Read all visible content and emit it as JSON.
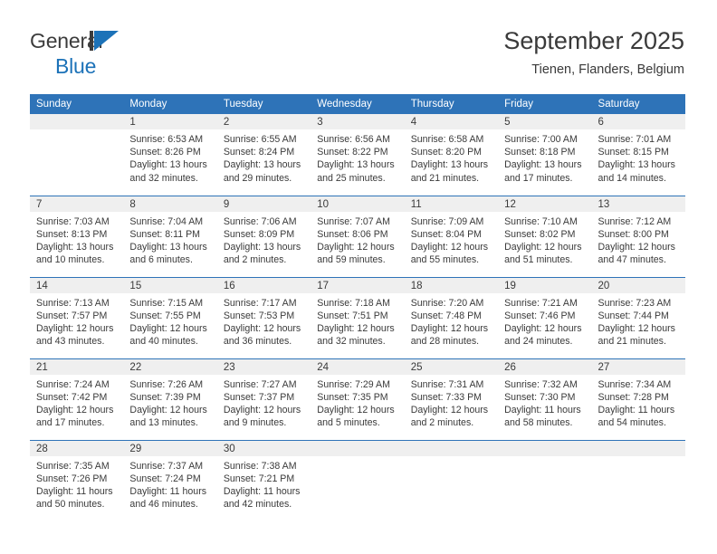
{
  "brand": {
    "name_top": "General",
    "name_bottom": "Blue",
    "accent_color": "#1c72b8",
    "text_color": "#3c3c3c"
  },
  "header": {
    "title": "September 2025",
    "subtitle": "Tienen, Flanders, Belgium"
  },
  "theme": {
    "header_blue": "#2e73b8",
    "daynum_band": "#efefef",
    "text": "#3a3a3a"
  },
  "calendar": {
    "weekday_headers": [
      "Sunday",
      "Monday",
      "Tuesday",
      "Wednesday",
      "Thursday",
      "Friday",
      "Saturday"
    ],
    "weeks": [
      [
        {
          "day": "",
          "empty": true,
          "sunrise": "",
          "sunset": "",
          "daylight_line1": "",
          "daylight_line2": ""
        },
        {
          "day": "1",
          "empty": false,
          "sunrise": "Sunrise: 6:53 AM",
          "sunset": "Sunset: 8:26 PM",
          "daylight_line1": "Daylight: 13 hours",
          "daylight_line2": "and 32 minutes."
        },
        {
          "day": "2",
          "empty": false,
          "sunrise": "Sunrise: 6:55 AM",
          "sunset": "Sunset: 8:24 PM",
          "daylight_line1": "Daylight: 13 hours",
          "daylight_line2": "and 29 minutes."
        },
        {
          "day": "3",
          "empty": false,
          "sunrise": "Sunrise: 6:56 AM",
          "sunset": "Sunset: 8:22 PM",
          "daylight_line1": "Daylight: 13 hours",
          "daylight_line2": "and 25 minutes."
        },
        {
          "day": "4",
          "empty": false,
          "sunrise": "Sunrise: 6:58 AM",
          "sunset": "Sunset: 8:20 PM",
          "daylight_line1": "Daylight: 13 hours",
          "daylight_line2": "and 21 minutes."
        },
        {
          "day": "5",
          "empty": false,
          "sunrise": "Sunrise: 7:00 AM",
          "sunset": "Sunset: 8:18 PM",
          "daylight_line1": "Daylight: 13 hours",
          "daylight_line2": "and 17 minutes."
        },
        {
          "day": "6",
          "empty": false,
          "sunrise": "Sunrise: 7:01 AM",
          "sunset": "Sunset: 8:15 PM",
          "daylight_line1": "Daylight: 13 hours",
          "daylight_line2": "and 14 minutes."
        }
      ],
      [
        {
          "day": "7",
          "empty": false,
          "sunrise": "Sunrise: 7:03 AM",
          "sunset": "Sunset: 8:13 PM",
          "daylight_line1": "Daylight: 13 hours",
          "daylight_line2": "and 10 minutes."
        },
        {
          "day": "8",
          "empty": false,
          "sunrise": "Sunrise: 7:04 AM",
          "sunset": "Sunset: 8:11 PM",
          "daylight_line1": "Daylight: 13 hours",
          "daylight_line2": "and 6 minutes."
        },
        {
          "day": "9",
          "empty": false,
          "sunrise": "Sunrise: 7:06 AM",
          "sunset": "Sunset: 8:09 PM",
          "daylight_line1": "Daylight: 13 hours",
          "daylight_line2": "and 2 minutes."
        },
        {
          "day": "10",
          "empty": false,
          "sunrise": "Sunrise: 7:07 AM",
          "sunset": "Sunset: 8:06 PM",
          "daylight_line1": "Daylight: 12 hours",
          "daylight_line2": "and 59 minutes."
        },
        {
          "day": "11",
          "empty": false,
          "sunrise": "Sunrise: 7:09 AM",
          "sunset": "Sunset: 8:04 PM",
          "daylight_line1": "Daylight: 12 hours",
          "daylight_line2": "and 55 minutes."
        },
        {
          "day": "12",
          "empty": false,
          "sunrise": "Sunrise: 7:10 AM",
          "sunset": "Sunset: 8:02 PM",
          "daylight_line1": "Daylight: 12 hours",
          "daylight_line2": "and 51 minutes."
        },
        {
          "day": "13",
          "empty": false,
          "sunrise": "Sunrise: 7:12 AM",
          "sunset": "Sunset: 8:00 PM",
          "daylight_line1": "Daylight: 12 hours",
          "daylight_line2": "and 47 minutes."
        }
      ],
      [
        {
          "day": "14",
          "empty": false,
          "sunrise": "Sunrise: 7:13 AM",
          "sunset": "Sunset: 7:57 PM",
          "daylight_line1": "Daylight: 12 hours",
          "daylight_line2": "and 43 minutes."
        },
        {
          "day": "15",
          "empty": false,
          "sunrise": "Sunrise: 7:15 AM",
          "sunset": "Sunset: 7:55 PM",
          "daylight_line1": "Daylight: 12 hours",
          "daylight_line2": "and 40 minutes."
        },
        {
          "day": "16",
          "empty": false,
          "sunrise": "Sunrise: 7:17 AM",
          "sunset": "Sunset: 7:53 PM",
          "daylight_line1": "Daylight: 12 hours",
          "daylight_line2": "and 36 minutes."
        },
        {
          "day": "17",
          "empty": false,
          "sunrise": "Sunrise: 7:18 AM",
          "sunset": "Sunset: 7:51 PM",
          "daylight_line1": "Daylight: 12 hours",
          "daylight_line2": "and 32 minutes."
        },
        {
          "day": "18",
          "empty": false,
          "sunrise": "Sunrise: 7:20 AM",
          "sunset": "Sunset: 7:48 PM",
          "daylight_line1": "Daylight: 12 hours",
          "daylight_line2": "and 28 minutes."
        },
        {
          "day": "19",
          "empty": false,
          "sunrise": "Sunrise: 7:21 AM",
          "sunset": "Sunset: 7:46 PM",
          "daylight_line1": "Daylight: 12 hours",
          "daylight_line2": "and 24 minutes."
        },
        {
          "day": "20",
          "empty": false,
          "sunrise": "Sunrise: 7:23 AM",
          "sunset": "Sunset: 7:44 PM",
          "daylight_line1": "Daylight: 12 hours",
          "daylight_line2": "and 21 minutes."
        }
      ],
      [
        {
          "day": "21",
          "empty": false,
          "sunrise": "Sunrise: 7:24 AM",
          "sunset": "Sunset: 7:42 PM",
          "daylight_line1": "Daylight: 12 hours",
          "daylight_line2": "and 17 minutes."
        },
        {
          "day": "22",
          "empty": false,
          "sunrise": "Sunrise: 7:26 AM",
          "sunset": "Sunset: 7:39 PM",
          "daylight_line1": "Daylight: 12 hours",
          "daylight_line2": "and 13 minutes."
        },
        {
          "day": "23",
          "empty": false,
          "sunrise": "Sunrise: 7:27 AM",
          "sunset": "Sunset: 7:37 PM",
          "daylight_line1": "Daylight: 12 hours",
          "daylight_line2": "and 9 minutes."
        },
        {
          "day": "24",
          "empty": false,
          "sunrise": "Sunrise: 7:29 AM",
          "sunset": "Sunset: 7:35 PM",
          "daylight_line1": "Daylight: 12 hours",
          "daylight_line2": "and 5 minutes."
        },
        {
          "day": "25",
          "empty": false,
          "sunrise": "Sunrise: 7:31 AM",
          "sunset": "Sunset: 7:33 PM",
          "daylight_line1": "Daylight: 12 hours",
          "daylight_line2": "and 2 minutes."
        },
        {
          "day": "26",
          "empty": false,
          "sunrise": "Sunrise: 7:32 AM",
          "sunset": "Sunset: 7:30 PM",
          "daylight_line1": "Daylight: 11 hours",
          "daylight_line2": "and 58 minutes."
        },
        {
          "day": "27",
          "empty": false,
          "sunrise": "Sunrise: 7:34 AM",
          "sunset": "Sunset: 7:28 PM",
          "daylight_line1": "Daylight: 11 hours",
          "daylight_line2": "and 54 minutes."
        }
      ],
      [
        {
          "day": "28",
          "empty": false,
          "sunrise": "Sunrise: 7:35 AM",
          "sunset": "Sunset: 7:26 PM",
          "daylight_line1": "Daylight: 11 hours",
          "daylight_line2": "and 50 minutes."
        },
        {
          "day": "29",
          "empty": false,
          "sunrise": "Sunrise: 7:37 AM",
          "sunset": "Sunset: 7:24 PM",
          "daylight_line1": "Daylight: 11 hours",
          "daylight_line2": "and 46 minutes."
        },
        {
          "day": "30",
          "empty": false,
          "sunrise": "Sunrise: 7:38 AM",
          "sunset": "Sunset: 7:21 PM",
          "daylight_line1": "Daylight: 11 hours",
          "daylight_line2": "and 42 minutes."
        },
        {
          "day": "",
          "empty": true,
          "sunrise": "",
          "sunset": "",
          "daylight_line1": "",
          "daylight_line2": ""
        },
        {
          "day": "",
          "empty": true,
          "sunrise": "",
          "sunset": "",
          "daylight_line1": "",
          "daylight_line2": ""
        },
        {
          "day": "",
          "empty": true,
          "sunrise": "",
          "sunset": "",
          "daylight_line1": "",
          "daylight_line2": ""
        },
        {
          "day": "",
          "empty": true,
          "sunrise": "",
          "sunset": "",
          "daylight_line1": "",
          "daylight_line2": ""
        }
      ]
    ]
  }
}
